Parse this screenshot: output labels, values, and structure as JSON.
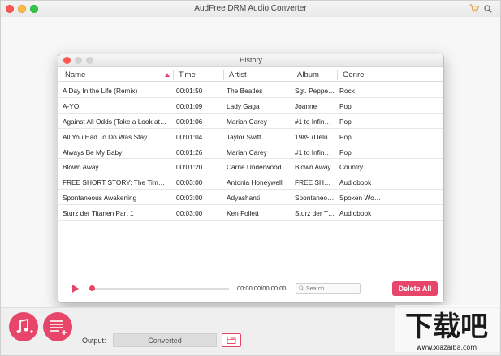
{
  "app": {
    "title": "AudFree DRM Audio Converter"
  },
  "icons": {
    "cart": "cart-icon",
    "search": "search-icon"
  },
  "history": {
    "title": "History",
    "columns": [
      "Name",
      "Time",
      "Artist",
      "Album",
      "Genre"
    ],
    "rows": [
      [
        "A Day In the Life (Remix)",
        "00:01:50",
        "The Beatles",
        "Sgt. Peppe…",
        "Rock"
      ],
      [
        "A-YO",
        "00:01:09",
        "Lady Gaga",
        "Joanne",
        "Pop"
      ],
      [
        "Against All Odds (Take a Look at …",
        "00:01:06",
        "Mariah Carey",
        "#1 to Infin…",
        "Pop"
      ],
      [
        "All You Had To Do Was Stay",
        "00:01:04",
        "Taylor Swift",
        "1989 (Delu…",
        "Pop"
      ],
      [
        "Always Be My Baby",
        "00:01:26",
        "Mariah Carey",
        "#1 to Infin…",
        "Pop"
      ],
      [
        "Blown Away",
        "00:01:20",
        "Carrie Underwood",
        "Blown Away",
        "Country"
      ],
      [
        "FREE SHORT STORY: The Time B…",
        "00:03:00",
        "Antonia Honeywell",
        "FREE SHO…",
        "Audiobook"
      ],
      [
        "Spontaneous Awakening",
        "00:03:00",
        "Adyashanti",
        "Spontaneo…",
        "Spoken Wo…"
      ],
      [
        "Sturz der Titanen Part 1",
        "00:03:00",
        "Ken Follett",
        "Sturz der T…",
        "Audiobook"
      ]
    ],
    "player": {
      "time": "00:00:00/00:00:00",
      "progress": 0,
      "search_placeholder": "Search"
    },
    "delete_label": "Delete All"
  },
  "bottom": {
    "output_label": "Output:",
    "output_value": "Converted"
  },
  "watermark": {
    "text": "下载吧",
    "url": "www.xiazaiba.com"
  },
  "colors": {
    "accent": "#e8456a"
  }
}
